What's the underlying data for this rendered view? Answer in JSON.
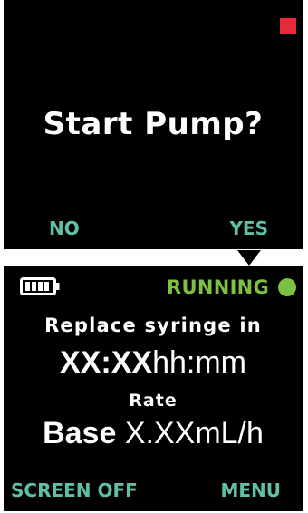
{
  "screen1": {
    "prompt": "Start Pump?",
    "no_label": "NO",
    "yes_label": "YES",
    "stop_color": "#e52b3a"
  },
  "screen2": {
    "battery": {
      "icon": "battery-full-icon",
      "level_fraction": 1.0
    },
    "status_text": "RUNNING",
    "status_color": "#7cc142",
    "replace_label": "Replace syringe in",
    "time_value": "XX:XX",
    "time_unit": "hh:mm",
    "rate_label": "Rate",
    "rate_mode": "Base",
    "rate_value": "X.XX",
    "rate_unit": "mL/h",
    "screen_off_label": "SCREEN OFF",
    "menu_label": "MENU"
  },
  "softkey_color": "#61bfa8"
}
